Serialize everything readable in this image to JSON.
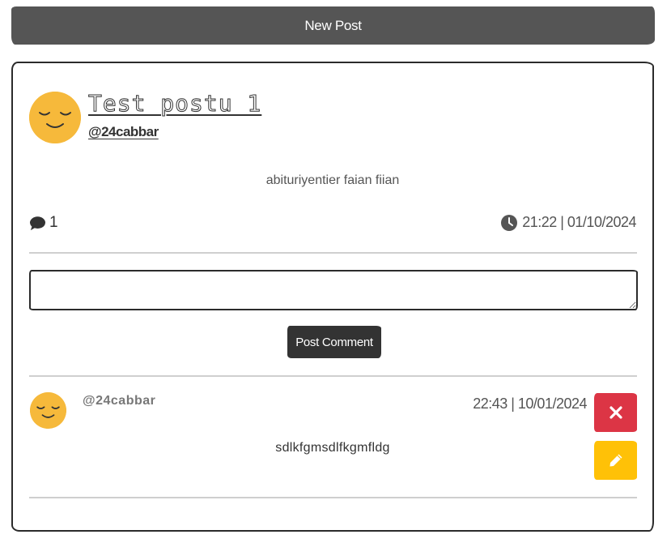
{
  "header": {
    "new_post_label": "New Post"
  },
  "post": {
    "title": "Test postu 1",
    "author": "@24cabbar",
    "body": "abituriyentier faian fiian",
    "comment_count": "1",
    "timestamp": "21:22 | 01/10/2024",
    "avatar_icon": "sleepy-face-icon",
    "comment_icon": "comment-icon",
    "clock_icon": "clock-icon"
  },
  "comment_form": {
    "input_value": "",
    "submit_label": "Post Comment"
  },
  "comments": [
    {
      "author": "@24cabbar",
      "timestamp": "22:43 | 10/01/2024",
      "body": "sdlkfgmsdlfkgmfldg",
      "delete_icon": "close-icon",
      "edit_icon": "pencil-icon"
    }
  ],
  "colors": {
    "avatar": "#f6b93b",
    "header_button": "#555555",
    "submit_button": "#333333",
    "delete_button": "#dc3545",
    "edit_button": "#ffc107"
  }
}
